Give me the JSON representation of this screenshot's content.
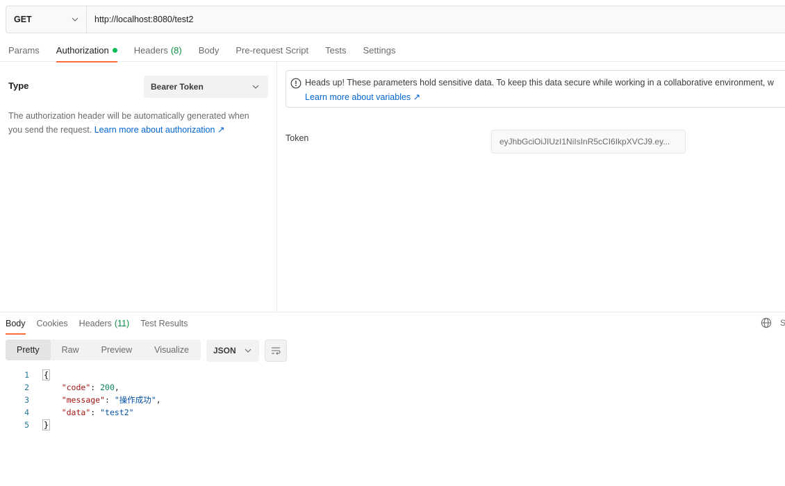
{
  "request": {
    "method": "GET",
    "url": "http://localhost:8080/test2"
  },
  "request_tabs": [
    {
      "label": "Params",
      "count": ""
    },
    {
      "label": "Authorization",
      "count": ""
    },
    {
      "label": "Headers",
      "count": "(8)"
    },
    {
      "label": "Body",
      "count": ""
    },
    {
      "label": "Pre-request Script",
      "count": ""
    },
    {
      "label": "Tests",
      "count": ""
    },
    {
      "label": "Settings",
      "count": ""
    }
  ],
  "auth": {
    "type_label": "Type",
    "type_value": "Bearer Token",
    "description": "The authorization header will be automatically generated when you send the request.",
    "learn_more": "Learn more about authorization ↗",
    "alert_text": "Heads up! These parameters hold sensitive data. To keep this data secure while working in a collaborative environment, w",
    "alert_link": "Learn more about variables ↗",
    "token_label": "Token",
    "token_value": "eyJhbGciOiJIUzI1NiIsInR5cCI6IkpXVCJ9.ey..."
  },
  "response_tabs": [
    {
      "label": "Body",
      "count": ""
    },
    {
      "label": "Cookies",
      "count": ""
    },
    {
      "label": "Headers",
      "count": "(11)"
    },
    {
      "label": "Test Results",
      "count": ""
    }
  ],
  "save_partial": "S",
  "view_modes": [
    "Pretty",
    "Raw",
    "Preview",
    "Visualize"
  ],
  "format": "JSON",
  "response_body": {
    "line_numbers": [
      "1",
      "2",
      "3",
      "4",
      "5"
    ],
    "open_brace": "{",
    "close_brace": "}",
    "fields": [
      {
        "key": "\"code\"",
        "value": "200"
      },
      {
        "key": "\"message\"",
        "value": "\"操作成功\""
      },
      {
        "key": "\"data\"",
        "value": "\"test2\""
      }
    ]
  },
  "colors": {
    "accent": "#ff6c37",
    "active_dot": "#0cbb52",
    "link": "#0265d2",
    "count_green": "#0a8f41"
  }
}
